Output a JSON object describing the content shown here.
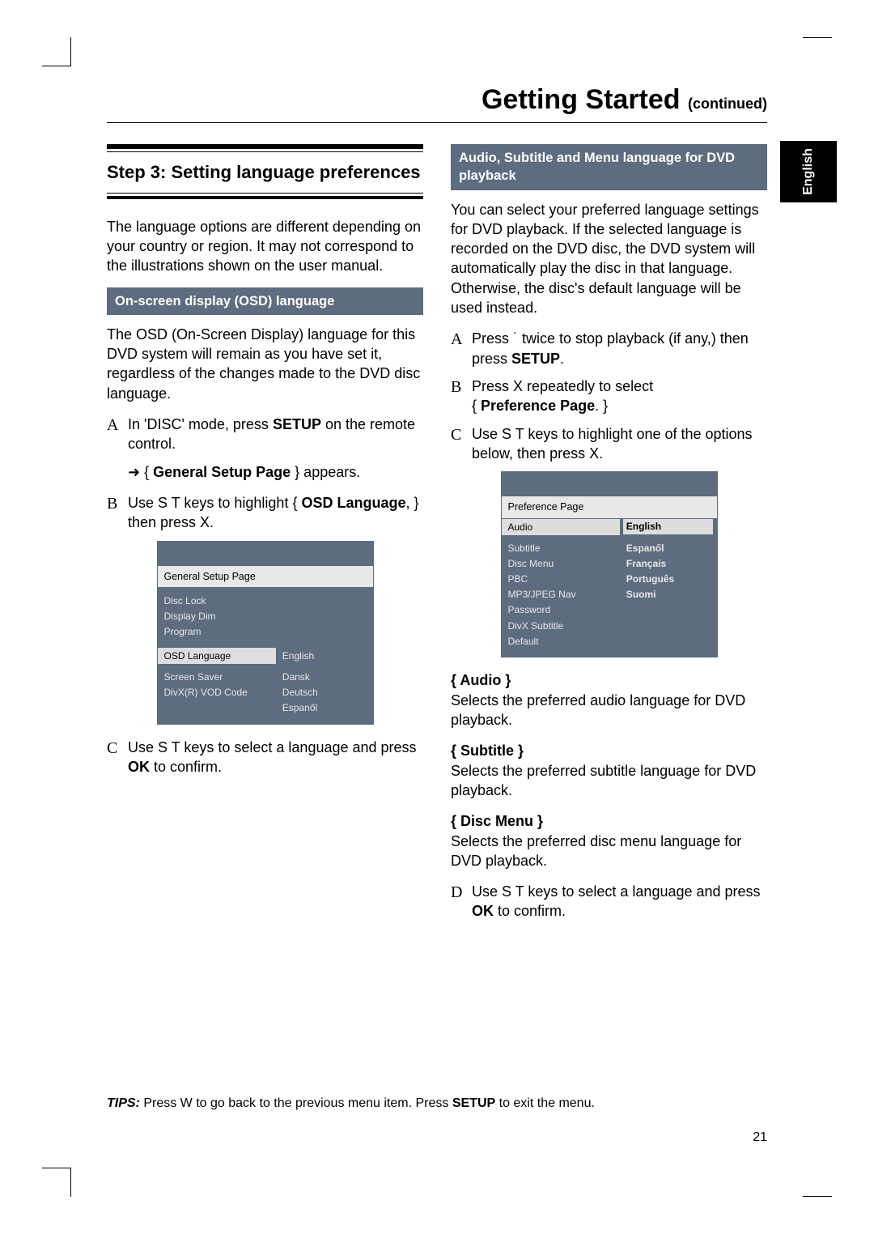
{
  "page": {
    "title_big": "Getting Started ",
    "title_small": "(continued)",
    "lang_tab": "English",
    "page_number": "21"
  },
  "left": {
    "step_title": "Step 3:  Setting language preferences",
    "intro": "The language options are different depending on your country or region.  It may not correspond to the illustrations shown on the user manual.",
    "osd_header": "On-screen display (OSD) language",
    "osd_intro": "The OSD (On-Screen Display) language for this DVD system will remain as you have set it, regardless of the changes made to the DVD disc language.",
    "a_pre": "In 'DISC' mode, press ",
    "a_setup": "SETUP",
    "a_post": " on the remote control.",
    "a_arrow": "➜  { ",
    "a_arrow_bold": "General Setup Page",
    "a_arrow_post": " } appears.",
    "b_pre": "Use  S T keys to highlight { ",
    "b_bold": "OSD Language",
    "b_post": ", } then press  X.",
    "c_pre": "Use  S T keys to select a language and press ",
    "c_bold": "OK",
    "c_post": " to confirm."
  },
  "menu1": {
    "title": "General Setup Page",
    "left_items": [
      "Disc Lock",
      "Display Dim",
      "Program"
    ],
    "sel_left": "OSD Language",
    "sel_right": "English",
    "left_items2": [
      "Screen Saver",
      "DivX(R) VOD Code"
    ],
    "right_items2": [
      "Dansk",
      "Deutsch",
      "Espanől"
    ]
  },
  "right": {
    "dvd_header": "Audio, Subtitle and Menu language for DVD playback",
    "dvd_intro": "You can select your preferred language settings for DVD playback.  If the selected language is recorded on the DVD disc, the DVD system will automatically play the disc in that language.  Otherwise, the disc's default language will be used instead.",
    "a_pre": "Press  ˙   twice to stop playback (if any,) then press ",
    "a_bold": "SETUP",
    "a_post": ".",
    "b_pre": "Press  X repeatedly to select ",
    "b_bold_open": "{ ",
    "b_bold": "Preference Page",
    "b_bold_close": ". }",
    "c_text": "Use  S T keys to highlight one of the options below, then press  X.",
    "audio_h": "{ Audio }",
    "audio_t": "Selects the preferred audio language for DVD playback.",
    "sub_h": "{ Subtitle }",
    "sub_t": "Selects the preferred subtitle language for DVD playback.",
    "menu_h": "{ Disc Menu }",
    "menu_t": "Selects the preferred disc menu language for DVD playback.",
    "d_pre": "Use  S T keys to select a language and press ",
    "d_bold": "OK",
    "d_post": " to confirm."
  },
  "menu2": {
    "title": "Preference Page",
    "sel_left": "Audio",
    "left_items": [
      "Subtitle",
      "Disc Menu",
      "PBC",
      "MP3/JPEG Nav",
      "Password",
      "DivX Subtitle",
      "Default"
    ],
    "right_sel": "English",
    "right_items": [
      "Espanől",
      "Français",
      "Português",
      "Suomi"
    ]
  },
  "tips": {
    "label": "TIPS:",
    "pre": "   Press  W to go back to the previous menu item.  Press ",
    "bold": "SETUP",
    "post": " to exit the menu."
  }
}
